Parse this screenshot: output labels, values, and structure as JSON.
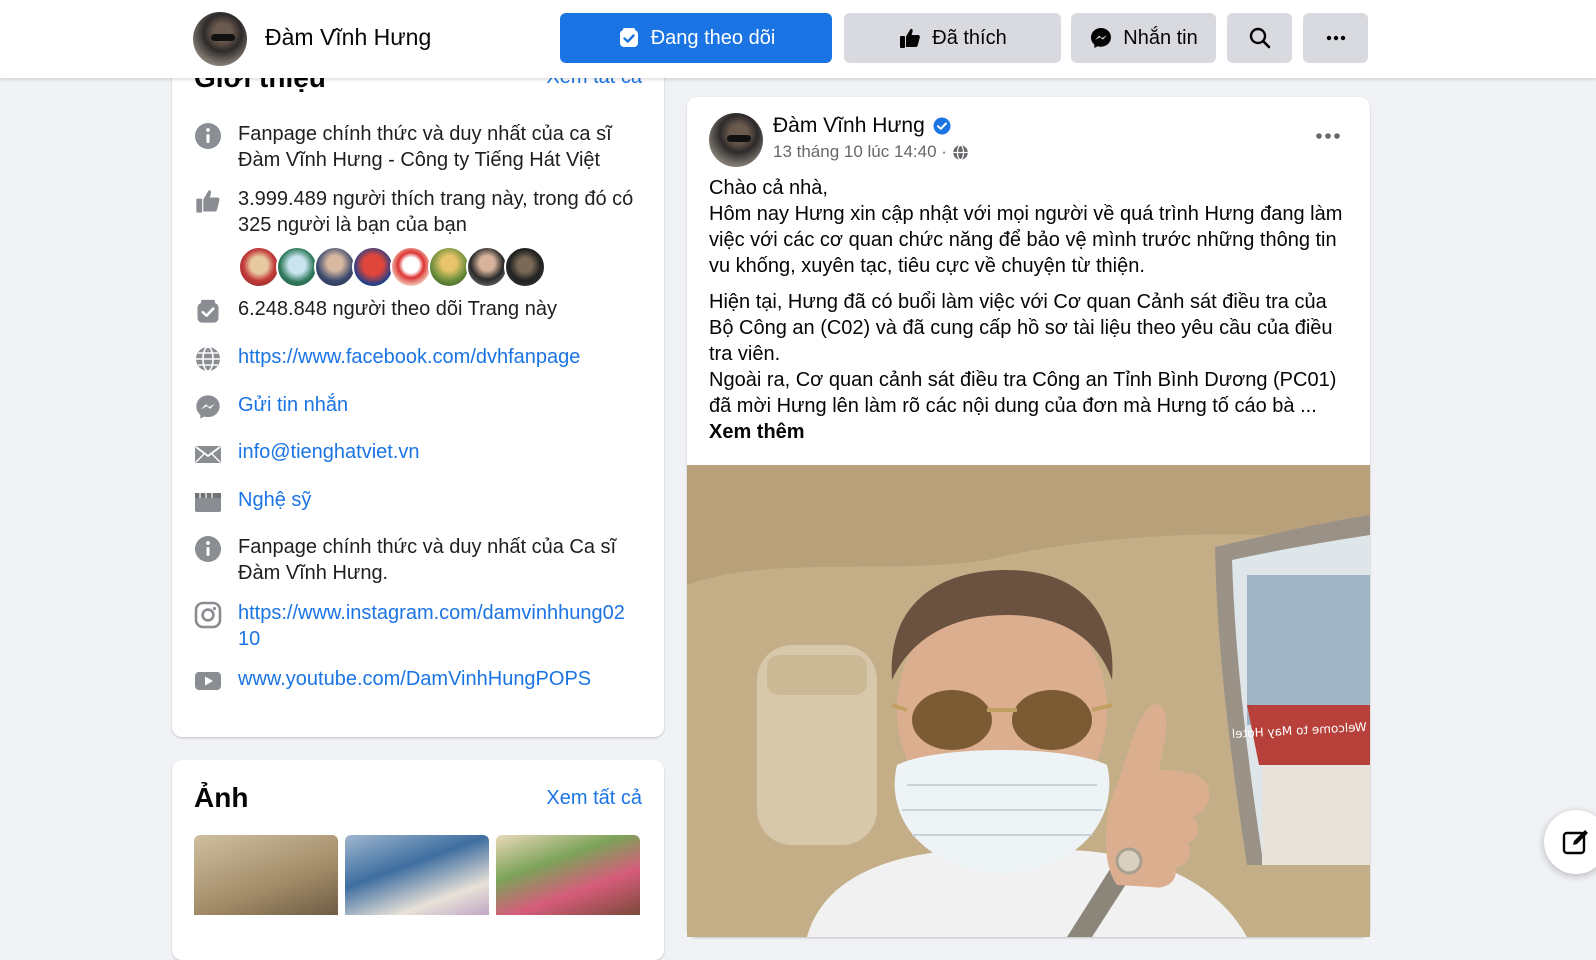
{
  "header": {
    "page_name": "Đàm Vĩnh Hưng",
    "following_label": "Đang theo dõi",
    "liked_label": "Đã thích",
    "message_label": "Nhắn tin"
  },
  "intro": {
    "title": "Giới thiệu",
    "see_all": "Xem tất cả",
    "description": "Fanpage chính thức và duy nhất của ca sĩ Đàm Vĩnh Hưng - Công ty Tiếng Hát Việt",
    "likes": "3.999.489 người thích trang này, trong đó có 325 người là bạn của bạn",
    "followers": "6.248.848 người theo dõi Trang này",
    "website": "https://www.facebook.com/dvhfanpage",
    "send_message": "Gửi tin nhắn",
    "email": "info@tienghatviet.vn",
    "category": "Nghệ sỹ",
    "about": "Fanpage chính thức và duy nhất của Ca sĩ Đàm Vĩnh Hưng.",
    "instagram": "https://www.instagram.com/damvinhhung0210",
    "youtube": "www.youtube.com/DamVinhHungPOPS"
  },
  "photos": {
    "title": "Ảnh",
    "see_all": "Xem tất cả"
  },
  "post": {
    "author": "Đàm Vĩnh Hưng",
    "timestamp": "13 tháng 10 lúc 14:40 ·",
    "paragraph1": "Chào cả nhà,\nHôm nay Hưng xin cập nhật với mọi người về quá trình Hưng đang làm việc với các cơ quan chức năng để bảo vệ mình trước những thông tin vu khống, xuyên tạc, tiêu cực về chuyện từ thiện.",
    "paragraph2": "Hiện tại, Hưng đã có buổi làm việc với Cơ quan Cảnh sát điều tra của Bộ Công an (C02) và đã cung cấp hồ sơ tài liệu theo yêu cầu của điều tra viên.\nNgoài ra, Cơ quan cảnh sát điều tra  Công an Tỉnh Bình Dương (PC01) đã mời Hưng lên làm rõ các nội dung của đơn mà Hưng tố cáo bà ...",
    "see_more": "Xem thêm",
    "photo_sign_text": "Welcome to May Hotel"
  },
  "colors": {
    "accent": "#1b74e4",
    "background": "#f0f2f5",
    "button_gray": "#d8dadf",
    "secondary_text": "#65676b"
  }
}
